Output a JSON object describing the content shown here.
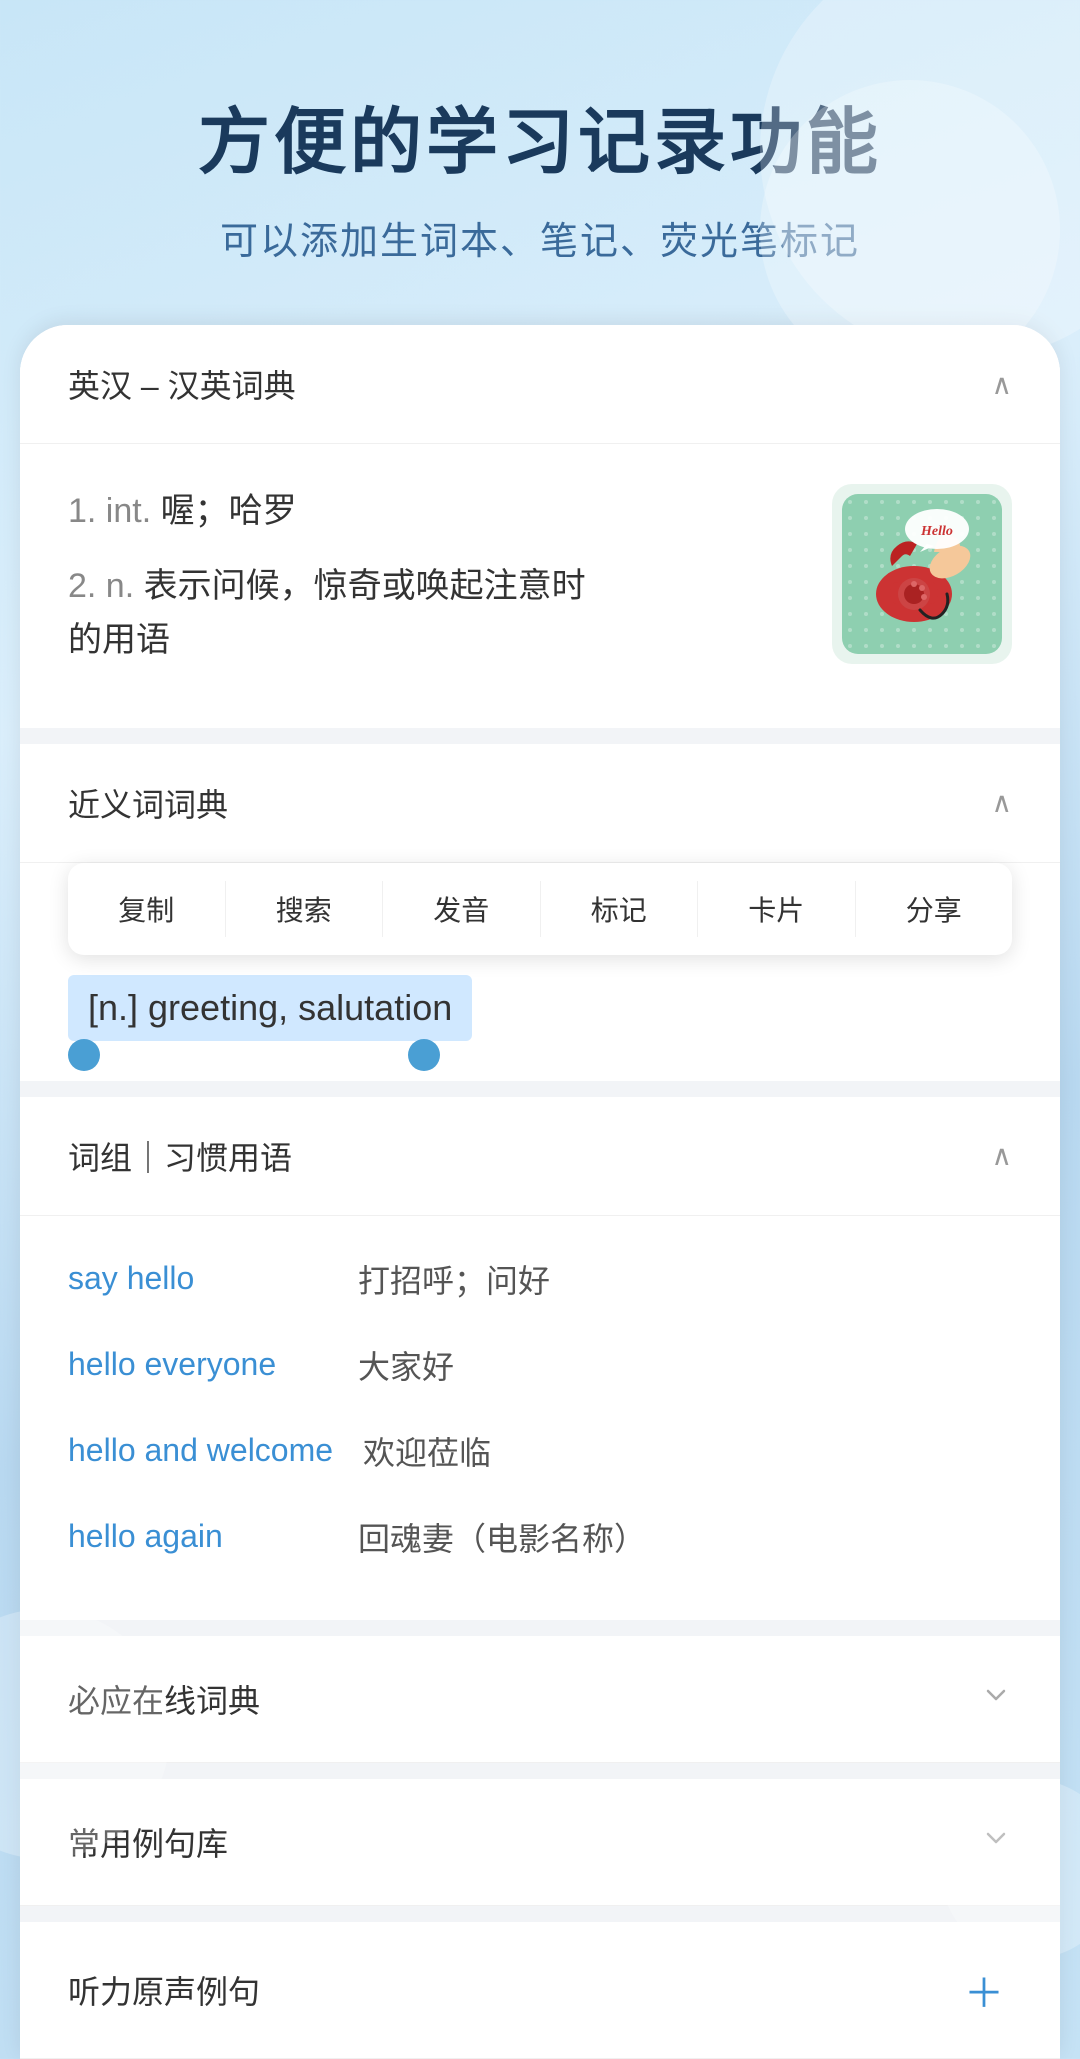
{
  "header": {
    "title": "方便的学习记录功能",
    "subtitle": "可以添加生词本、笔记、荧光笔标记"
  },
  "dict_section": {
    "title": "英汉 – 汉英词典",
    "chevron": "^",
    "definitions": [
      {
        "num": "1.",
        "pos": "int.",
        "meaning": "喔；哈罗"
      },
      {
        "num": "2.",
        "pos": "n.",
        "meaning": "表示问候，惊奇或唤起注意时的用语"
      }
    ]
  },
  "synonyms_section": {
    "title": "近义词词典",
    "chevron": "^"
  },
  "context_menu": {
    "items": [
      "复制",
      "搜索",
      "发音",
      "标记",
      "卡片",
      "分享"
    ]
  },
  "selected_text": "[n.] greeting, salutation",
  "phrases_section": {
    "title": "词组｜习惯用语",
    "chevron": "^",
    "items": [
      {
        "en": "say hello",
        "zh": "打招呼；问好"
      },
      {
        "en": "hello everyone",
        "zh": "大家好"
      },
      {
        "en": "hello and welcome",
        "zh": "欢迎莅临"
      },
      {
        "en": "hello again",
        "zh": "回魂妻（电影名称）"
      }
    ]
  },
  "collapsed_sections": [
    {
      "title": "必应在线词典",
      "icon": "chevron-down"
    },
    {
      "title": "常用例句库",
      "icon": "chevron-down"
    },
    {
      "title": "听力原声例句",
      "icon": "plus"
    }
  ],
  "hello_image": {
    "speech_bubble": "Hello",
    "alt": "vintage telephone hello illustration"
  }
}
